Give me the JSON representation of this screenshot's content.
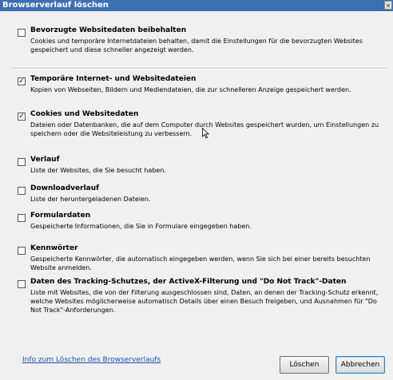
{
  "window": {
    "title": "Browserverlauf löschen",
    "close_glyph": "✕"
  },
  "options": [
    {
      "checked": false,
      "title": "Bevorzugte Websitedaten beibehalten",
      "description": "Cookies und temporäre Internetdateien behalten, damit die Einstellungen für die bevorzugten Websites gespeichert und diese schneller angezeigt werden."
    },
    {
      "checked": true,
      "title": "Temporäre Internet- und Websitedateien",
      "description": "Kopien von Webseiten, Bildern und Mediendateien, die zur schnelleren Anzeige gespeichert werden."
    },
    {
      "checked": true,
      "title": "Cookies und Websitedaten",
      "description": "Dateien oder Datenbanken, die auf dem Computer durch Websites gespeichert wurden, um Einstellungen zu speichern oder die Websiteleistung zu verbessern."
    },
    {
      "checked": false,
      "title": "Verlauf",
      "description": "Liste der Websites, die Sie besucht haben."
    },
    {
      "checked": false,
      "title": "Downloadverlauf",
      "description": "Liste der heruntergeladenen Dateien."
    },
    {
      "checked": false,
      "title": "Formulardaten",
      "description": "Gespeicherte Informationen, die Sie in Formulare eingegeben haben."
    },
    {
      "checked": false,
      "title": "Kennwörter",
      "description": "Gespeicherte Kennwörter, die automatisch eingegeben werden, wenn Sie sich bei einer bereits besuchten Website anmelden."
    },
    {
      "checked": false,
      "title": "Daten des Tracking-Schutzes, der ActiveX-Filterung und \"Do Not Track\"-Daten",
      "description": "Liste mit Websites, die von der Filterung ausgeschlossen sind, Daten, an denen der Tracking-Schutz erkennt, welche Websites möglicherweise automatisch Details über einen Besuch freigeben, und Ausnahmen für \"Do Not Track\"-Anforderungen."
    }
  ],
  "footer": {
    "help_link": "Info zum Löschen des Browserverlaufs",
    "delete_label": "Löschen",
    "cancel_label": "Abbrechen"
  },
  "checkmark_glyph": "✓"
}
